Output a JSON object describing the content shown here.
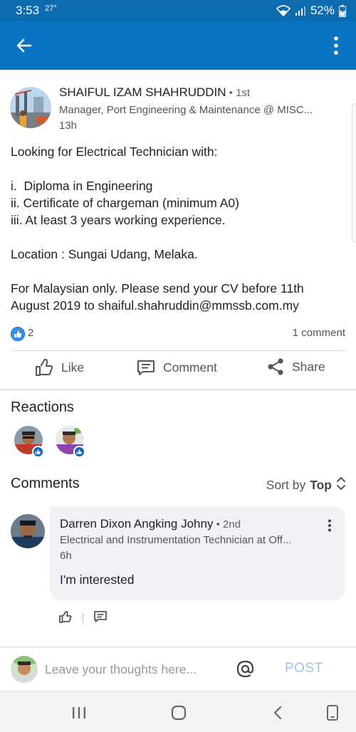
{
  "status_bar": {
    "time": "3:53",
    "temperature": "27°",
    "battery": "52%",
    "icons": [
      "wifi-icon",
      "signal-icon",
      "battery-icon"
    ]
  },
  "app_bar": {
    "back_icon": "arrow-left-icon",
    "menu_icon": "more-vertical-icon"
  },
  "post": {
    "author": {
      "name": "SHAIFUL IZAM SHAHRUDDIN",
      "degree": " • 1st",
      "title": "Manager, Port Engineering & Maintenance @ MISC...",
      "time": "13h"
    },
    "body_lines": [
      "Looking for Electrical Technician with:",
      "",
      "i.  Diploma in Engineering",
      "ii. Certificate of chargeman (minimum A0)",
      "iii. At least 3 years working experience.",
      "",
      "Location : Sungai Udang, Melaka.",
      "",
      "For Malaysian only. Please send your CV before 11th",
      "August 2019 to shaiful.shahruddin@mmssb.com.my"
    ],
    "like_count": "2",
    "comment_count": "1 comment",
    "actions": {
      "like": "Like",
      "comment": "Comment",
      "share": "Share"
    }
  },
  "reactions": {
    "title": "Reactions"
  },
  "comments": {
    "title": "Comments",
    "sort_label": "Sort by",
    "sort_value": "Top",
    "items": [
      {
        "name": "Darren Dixon Angking Johny",
        "degree": " • 2nd",
        "title": "Electrical and Instrumentation Technician at Off...",
        "time": "6h",
        "text": "I'm interested"
      }
    ]
  },
  "compose": {
    "placeholder": "Leave your thoughts here...",
    "post_label": "POST"
  },
  "colors": {
    "brand": "#0a74c2",
    "status_bar": "#0d6bb0",
    "post_disabled": "#9cc3e6"
  }
}
